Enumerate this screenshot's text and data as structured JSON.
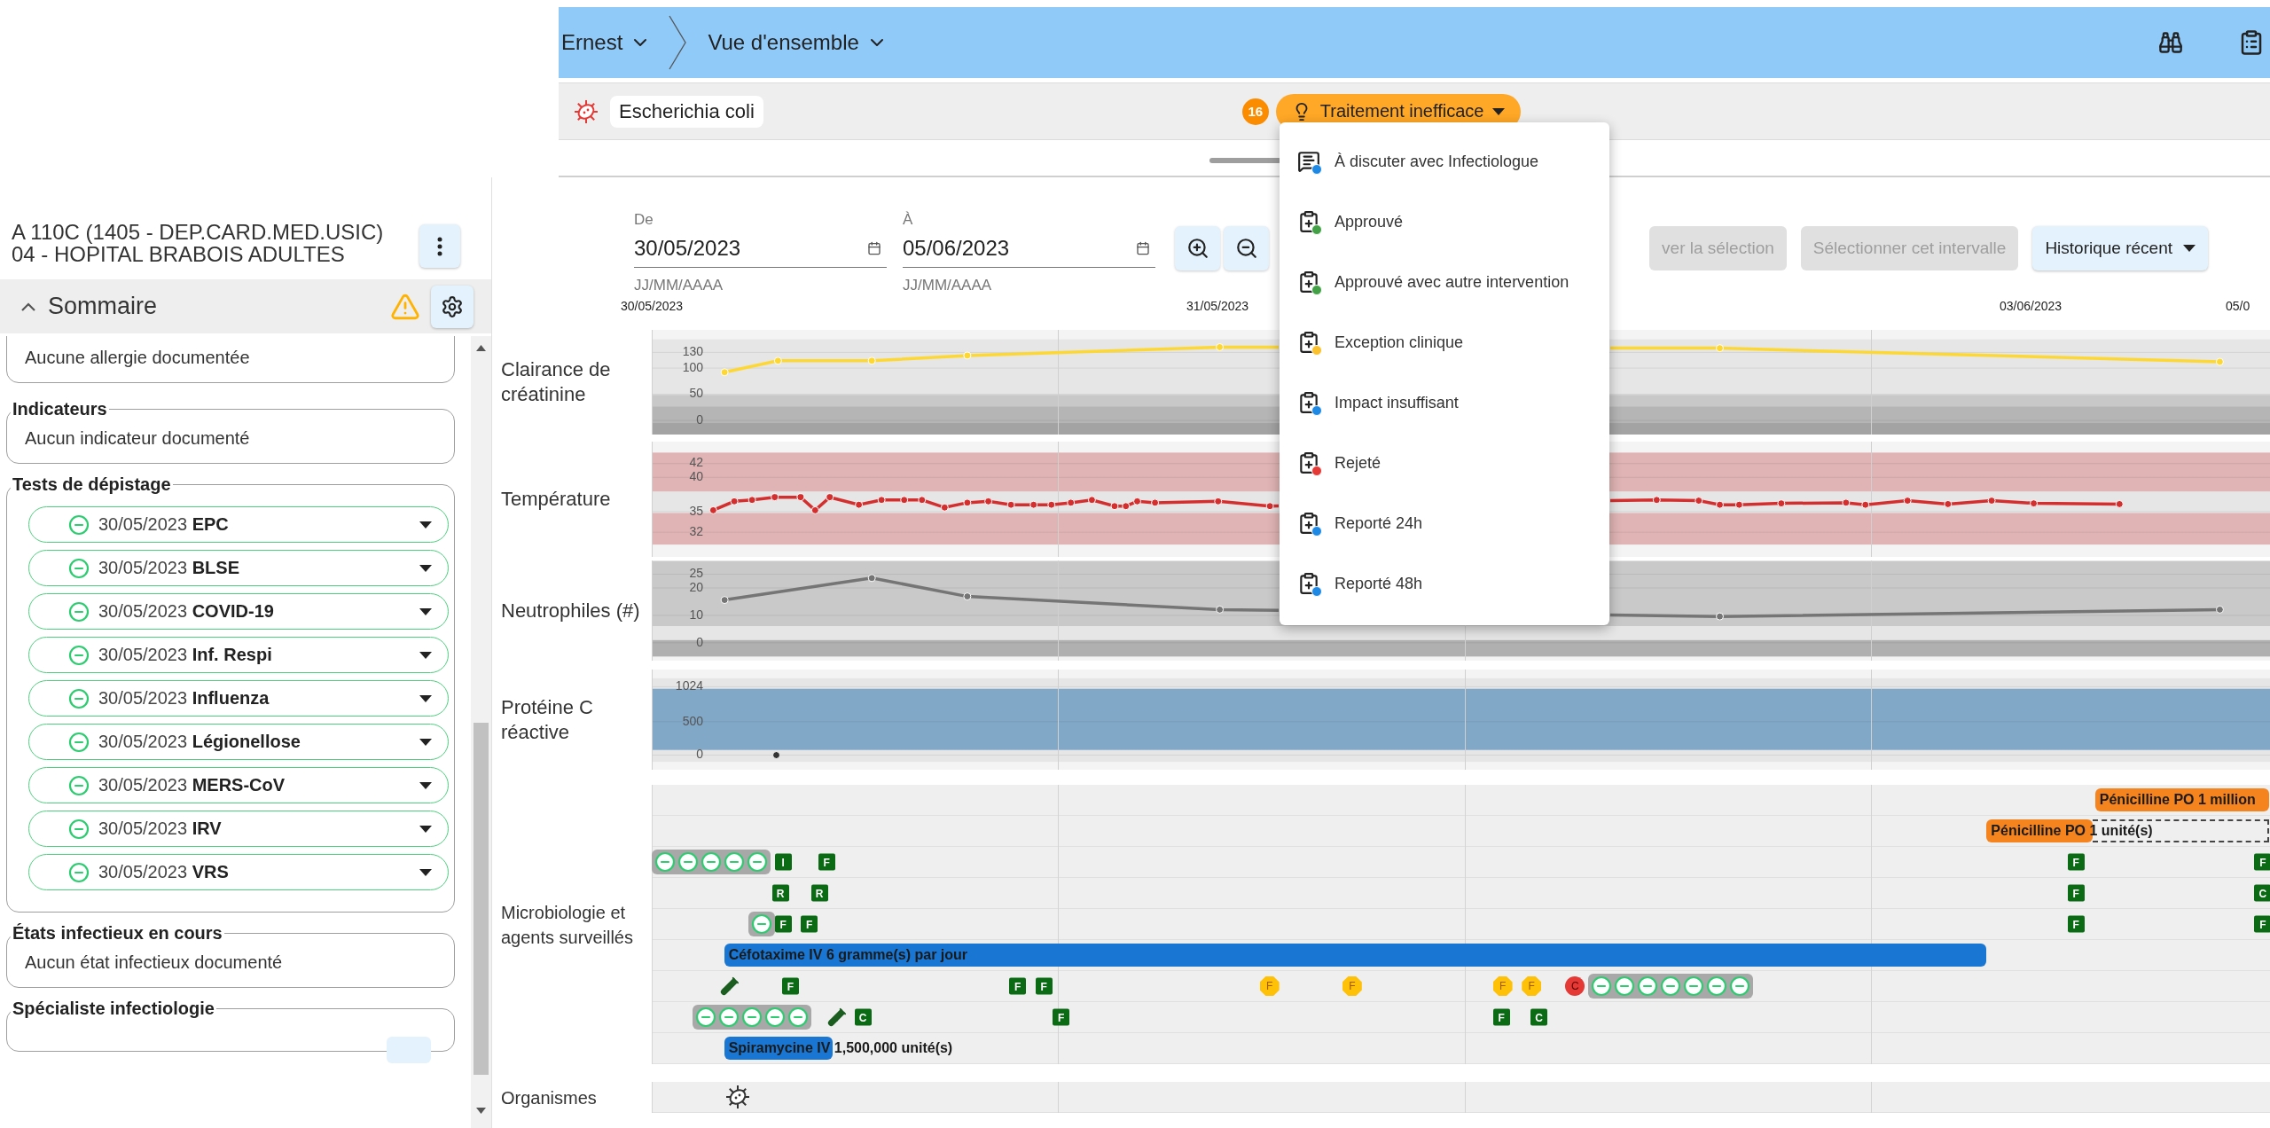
{
  "header": {
    "breadcrumbs": [
      {
        "label": "Ernest"
      },
      {
        "label": "Vue d'ensemble"
      }
    ]
  },
  "organism_chip": "Escherichia coli",
  "alert": {
    "count": "16",
    "label": "Traitement inefficace",
    "expanded": true
  },
  "alert_menu": {
    "items": [
      {
        "kind": "discuss",
        "label": "À discuter avec Infectiologue"
      },
      {
        "kind": "approved",
        "label": "Approuvé"
      },
      {
        "kind": "approved",
        "label": "Approuvé avec autre intervention"
      },
      {
        "kind": "exception",
        "label": "Exception clinique"
      },
      {
        "kind": "insufficient",
        "label": "Impact insuffisant"
      },
      {
        "kind": "rejected",
        "label": "Rejeté"
      },
      {
        "kind": "postponed",
        "label": "Reporté 24h"
      },
      {
        "kind": "postponed",
        "label": "Reporté 48h"
      }
    ]
  },
  "sidebar": {
    "patient_lines": [
      "A 110C (1405 - DEP.CARD.MED.USIC)",
      "04 - HOPITAL BRABOIS ADULTES"
    ],
    "summary": {
      "title": "Sommaire",
      "expanded": true,
      "warning": true
    },
    "groups": [
      {
        "kind": "text",
        "text": "Aucune allergie documentée"
      },
      {
        "kind": "text",
        "legend": "Indicateurs",
        "text": "Aucun indicateur documenté"
      },
      {
        "kind": "tests",
        "legend": "Tests de dépistage",
        "tests": [
          {
            "date": "30/05/2023",
            "name": "EPC",
            "negative": true
          },
          {
            "date": "30/05/2023",
            "name": "BLSE",
            "negative": true
          },
          {
            "date": "30/05/2023",
            "name": "COVID-19",
            "negative": true
          },
          {
            "date": "30/05/2023",
            "name": "Inf. Respi",
            "negative": true
          },
          {
            "date": "30/05/2023",
            "name": "Influenza",
            "negative": true
          },
          {
            "date": "30/05/2023",
            "name": "Légionellose",
            "negative": true
          },
          {
            "date": "30/05/2023",
            "name": "MERS-CoV",
            "negative": true
          },
          {
            "date": "30/05/2023",
            "name": "IRV",
            "negative": true
          },
          {
            "date": "30/05/2023",
            "name": "VRS",
            "negative": true
          }
        ]
      },
      {
        "kind": "text",
        "legend": "États infectieux en cours",
        "text": "Aucun état infectieux documenté"
      },
      {
        "kind": "specialist",
        "legend": "Spécialiste infectiologie"
      }
    ]
  },
  "controls": {
    "from": {
      "label": "De",
      "value": "30/05/2023",
      "helper": "JJ/MM/AAAA"
    },
    "to": {
      "label": "À",
      "value": "05/06/2023",
      "helper": "JJ/MM/AAAA"
    },
    "buttons": [
      {
        "label": "ver la sélection",
        "disabled": true,
        "dropdown": false
      },
      {
        "label": "Sélectionner cet intervalle",
        "disabled": true,
        "dropdown": false
      },
      {
        "label": "Historique récent",
        "disabled": false,
        "dropdown": true
      }
    ]
  },
  "time_axis": [
    {
      "label": "30/05/2023"
    },
    {
      "label": "31/05/2023"
    },
    {
      "label": "03/06/2023"
    },
    {
      "label": "05/0"
    }
  ],
  "vitals": [
    {
      "label": "Clairance de créatinine",
      "scale": [
        "130",
        "100",
        "50",
        "0"
      ]
    },
    {
      "label": "Température",
      "scale": [
        "42",
        "40",
        "35",
        "32"
      ]
    },
    {
      "label": "Neutrophiles (#)",
      "scale": [
        "25",
        "20",
        "10",
        "0"
      ]
    },
    {
      "label": "Protéine C réactive",
      "scale": [
        "1024",
        "500",
        "0"
      ]
    }
  ],
  "timeline": {
    "sections": [
      {
        "label": "Microbiologie et agents surveillés",
        "rows": [
          {
            "items": [
              {
                "kind": "drug",
                "label": "Pénicilline PO 1 million",
                "color": "#f5841f",
                "planned": false
              }
            ]
          },
          {
            "items": [
              {
                "kind": "drug",
                "label": "Pénicilline PO 1 unité(s)",
                "color": "#f5841f",
                "planned": true
              }
            ]
          },
          {
            "items": [
              {
                "kind": "negatives",
                "results": [
                  {
                    "negative": true
                  },
                  {
                    "negative": true
                  },
                  {
                    "negative": true
                  },
                  {
                    "negative": true
                  },
                  {
                    "negative": true
                  }
                ]
              },
              {
                "kind": "result",
                "letter": "I"
              },
              {
                "kind": "result",
                "letter": "F"
              },
              {
                "kind": "result",
                "letter": "F"
              },
              {
                "kind": "result",
                "letter": "F"
              }
            ]
          },
          {
            "items": [
              {
                "kind": "result",
                "letter": "R"
              },
              {
                "kind": "result",
                "letter": "R"
              },
              {
                "kind": "result",
                "letter": "F"
              },
              {
                "kind": "result",
                "letter": "C"
              }
            ]
          },
          {
            "items": [
              {
                "kind": "negatives",
                "results": [
                  {
                    "negative": true
                  }
                ]
              },
              {
                "kind": "result",
                "letter": "F"
              },
              {
                "kind": "result",
                "letter": "F"
              },
              {
                "kind": "result",
                "letter": "F"
              },
              {
                "kind": "result",
                "letter": "F"
              }
            ]
          },
          {
            "items": [
              {
                "kind": "drug",
                "label": "Céfotaxime IV 6 gramme(s) par jour",
                "color": "#1976d2",
                "planned": false
              }
            ]
          },
          {
            "items": [
              {
                "kind": "sample"
              },
              {
                "kind": "result",
                "letter": "F"
              },
              {
                "kind": "result",
                "letter": "F"
              },
              {
                "kind": "result",
                "letter": "F"
              },
              {
                "kind": "pending",
                "letter": "F"
              },
              {
                "kind": "pending",
                "letter": "F"
              },
              {
                "kind": "pending",
                "letter": "F"
              },
              {
                "kind": "pending",
                "letter": "F"
              },
              {
                "kind": "critical",
                "letter": "C"
              },
              {
                "kind": "negatives",
                "results": [
                  {
                    "negative": true
                  },
                  {
                    "negative": true
                  },
                  {
                    "negative": true
                  },
                  {
                    "negative": true
                  },
                  {
                    "negative": true
                  },
                  {
                    "negative": true
                  },
                  {
                    "negative": true
                  }
                ]
              }
            ]
          },
          {
            "items": [
              {
                "kind": "negatives",
                "results": [
                  {
                    "negative": true
                  },
                  {
                    "negative": true
                  },
                  {
                    "negative": true
                  },
                  {
                    "negative": true
                  },
                  {
                    "negative": true
                  }
                ]
              },
              {
                "kind": "sample"
              },
              {
                "kind": "result",
                "letter": "C"
              },
              {
                "kind": "result",
                "letter": "F"
              },
              {
                "kind": "result",
                "letter": "F"
              },
              {
                "kind": "result",
                "letter": "C"
              }
            ]
          },
          {
            "items": [
              {
                "kind": "drug",
                "label": "Spiramycine IV 1,500,000 unité(s)",
                "color": "#1976d2",
                "planned": false
              }
            ]
          }
        ]
      },
      {
        "label": "Organismes",
        "rows": [
          {
            "items": [
              {
                "kind": "organism"
              }
            ]
          }
        ]
      }
    ]
  }
}
